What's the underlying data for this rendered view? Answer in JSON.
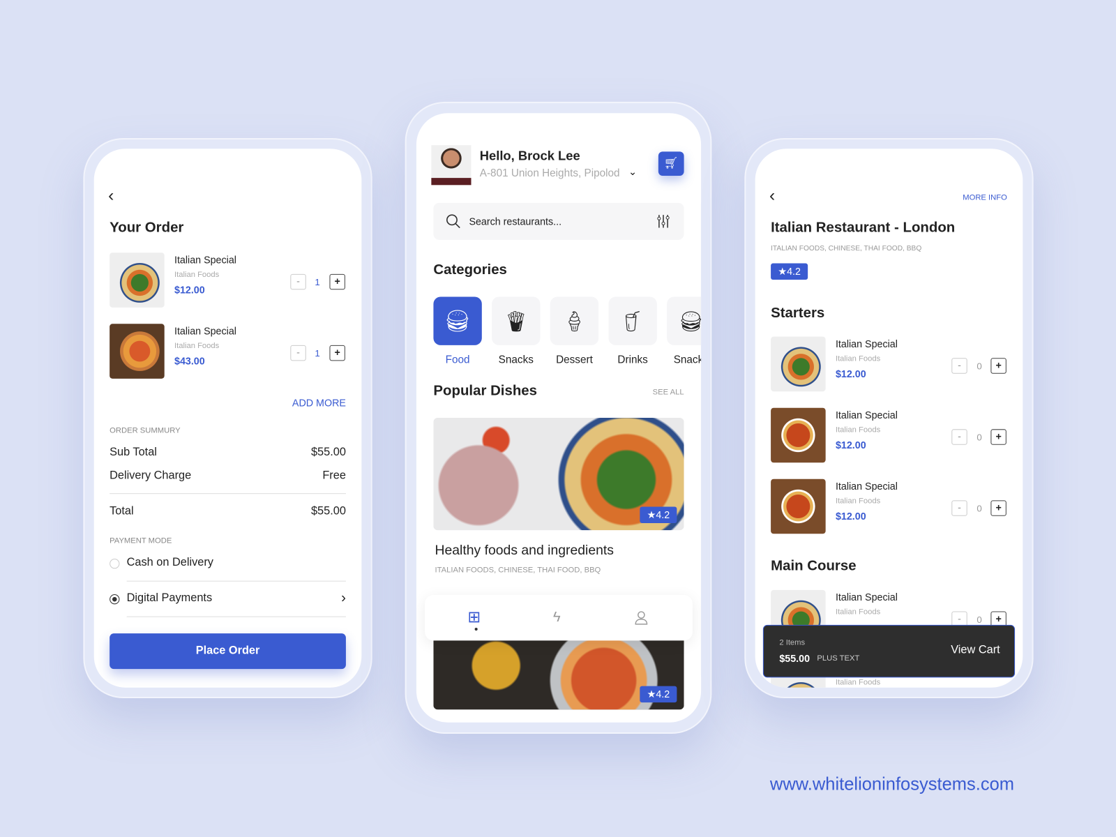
{
  "order": {
    "title": "Your Order",
    "items": [
      {
        "name": "Italian Special",
        "cat": "Italian Foods",
        "price": "$12.00",
        "qty": "1"
      },
      {
        "name": "Italian Special",
        "cat": "Italian Foods",
        "price": "$43.00",
        "qty": "1"
      }
    ],
    "add_more": "ADD MORE",
    "summary_label": "ORDER SUMMURY",
    "subtotal_label": "Sub Total",
    "subtotal": "$55.00",
    "delivery_label": "Delivery Charge",
    "delivery": "Free",
    "total_label": "Total",
    "total": "$55.00",
    "payment_label": "PAYMENT MODE",
    "pay_options": [
      "Cash on Delivery",
      "Digital Payments"
    ],
    "place_order": "Place Order"
  },
  "home": {
    "greeting": "Hello, Brock Lee",
    "address": "A-801 Union Heights, Pipolod",
    "search_placeholder": "Search restaurants...",
    "categories_title": "Categories",
    "categories": [
      "Food",
      "Snacks",
      "Dessert",
      "Drinks",
      "Snacks"
    ],
    "popular_title": "Popular Dishes",
    "see_all": "SEE ALL",
    "dishes": [
      {
        "title": "Healthy foods and ingredients",
        "tags": "ITALIAN FOODS, CHINESE, THAI FOOD, BBQ",
        "rating": "★4.2"
      },
      {
        "rating": "★4.2"
      }
    ]
  },
  "restaurant": {
    "more_info": "MORE INFO",
    "title": "Italian Restaurant - London",
    "tags": "ITALIAN FOODS, CHINESE, THAI FOOD, BBQ",
    "rating": "★4.2",
    "starters_title": "Starters",
    "starters": [
      {
        "name": "Italian Special",
        "cat": "Italian Foods",
        "price": "$12.00",
        "qty": "0"
      },
      {
        "name": "Italian Special",
        "cat": "Italian Foods",
        "price": "$12.00",
        "qty": "0"
      },
      {
        "name": "Italian Special",
        "cat": "Italian Foods",
        "price": "$12.00",
        "qty": "0"
      }
    ],
    "main_title": "Main Course",
    "main": [
      {
        "name": "Italian Special",
        "cat": "Italian Foods",
        "qty": "0"
      },
      {
        "cat": "Italian Foods"
      }
    ],
    "cart": {
      "items": "2 Items",
      "price": "$55.00",
      "plus": "PLUS TEXT",
      "view": "View Cart"
    }
  },
  "footer_url": "www.whitelioninfosystems.com",
  "colors": {
    "accent": "#3a5bd1",
    "background": "#dbe1f5",
    "cart_bar": "#2e2e2e"
  }
}
